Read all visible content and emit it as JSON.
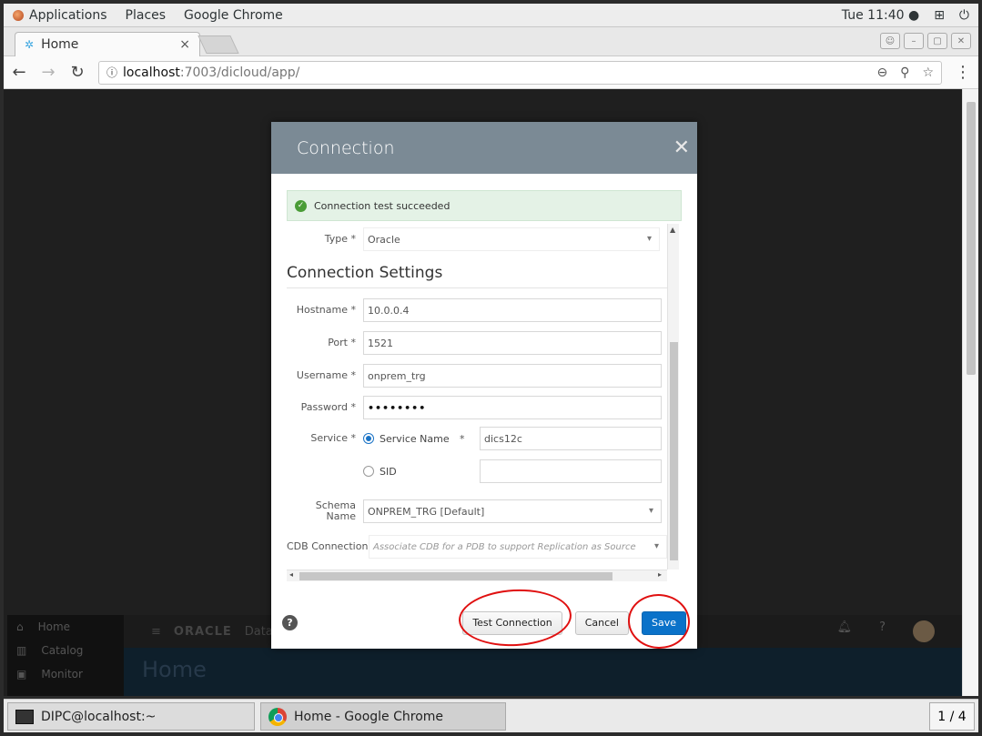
{
  "topbar": {
    "applications": "Applications",
    "places": "Places",
    "app_name": "Google Chrome",
    "clock": "Tue 11:40"
  },
  "browser": {
    "tab_title": "Home",
    "url_host": "localhost",
    "url_rest": ":7003/dicloud/app/"
  },
  "background_app": {
    "nav_home": "Home",
    "nav_catalog": "Catalog",
    "nav_monitor": "Monitor",
    "brand": "ORACLE",
    "brand_suffix": "Data",
    "page_title": "Home"
  },
  "dialog": {
    "title": "Connection",
    "success_message": "Connection test succeeded",
    "section_title": "Connection Settings",
    "fields": {
      "type_label": "Type *",
      "type_value": "Oracle",
      "hostname_label": "Hostname *",
      "hostname_value": "10.0.0.4",
      "port_label": "Port *",
      "port_value": "1521",
      "username_label": "Username *",
      "username_value": "onprem_trg",
      "password_label": "Password *",
      "password_value": "••••••••",
      "service_label": "Service *",
      "service_name_option": "Service Name",
      "service_name_required": "*",
      "service_name_value": "dics12c",
      "sid_option": "SID",
      "sid_value": "",
      "schema_label": "Schema Name",
      "schema_value": "ONPREM_TRG [Default]",
      "cdb_label": "CDB Connection",
      "cdb_placeholder": "Associate CDB for a PDB to support Replication as Source"
    },
    "buttons": {
      "help": "?",
      "test": "Test Connection",
      "cancel": "Cancel",
      "save": "Save"
    }
  },
  "taskbar": {
    "terminal_label": "DIPC@localhost:~",
    "chrome_label": "Home - Google Chrome",
    "workspace": "1 / 4"
  },
  "colors": {
    "dialog_header": "#7b8a95",
    "success_bg": "#e4f2e6",
    "primary_button": "#0a72c9",
    "annotation_ring": "#e01010"
  }
}
